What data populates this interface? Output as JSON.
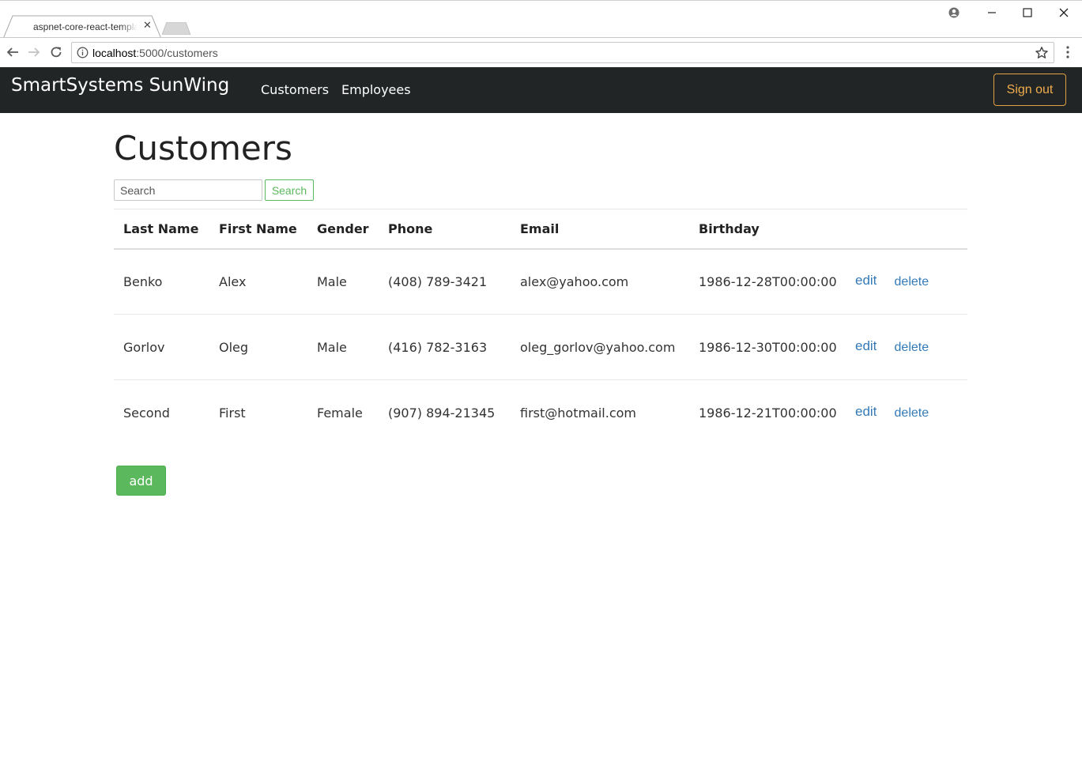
{
  "browser": {
    "tab_title": "aspnet-core-react-template",
    "url_host": "localhost",
    "url_path": ":5000/customers"
  },
  "navbar": {
    "brand": "SmartSystems SunWing",
    "links": [
      "Customers",
      "Employees"
    ],
    "signout_label": "Sign out",
    "colors": {
      "background": "#222526",
      "signout": "#f0ad4e"
    }
  },
  "main": {
    "title": "Customers",
    "search": {
      "placeholder": "Search",
      "button_label": "Search"
    },
    "table": {
      "headers": [
        "Last Name",
        "First Name",
        "Gender",
        "Phone",
        "Email",
        "Birthday"
      ],
      "rows": [
        {
          "last": "Benko",
          "first": "Alex",
          "gender": "Male",
          "phone": "(408) 789-3421",
          "email": "alex@yahoo.com",
          "birthday": "1986-12-28T00:00:00",
          "edit": "edit",
          "delete": "delete"
        },
        {
          "last": "Gorlov",
          "first": "Oleg",
          "gender": "Male",
          "phone": "(416) 782-3163",
          "email": "oleg_gorlov@yahoo.com",
          "birthday": "1986-12-30T00:00:00",
          "edit": "edit",
          "delete": "delete"
        },
        {
          "last": "Second",
          "first": "First",
          "gender": "Female",
          "phone": "(907) 894-21345",
          "email": "first@hotmail.com",
          "birthday": "1986-12-21T00:00:00",
          "edit": "edit",
          "delete": "delete"
        }
      ]
    },
    "add_label": "add",
    "colors": {
      "link": "#337ab7",
      "success": "#5cb85c"
    }
  }
}
